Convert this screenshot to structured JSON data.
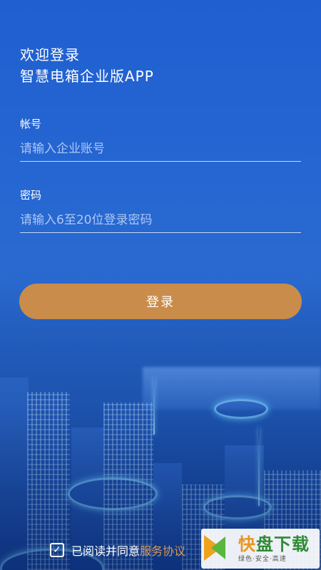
{
  "header": {
    "welcome": "欢迎登录",
    "app_name": "智慧电箱企业版APP"
  },
  "account": {
    "label": "帐号",
    "placeholder": "请输入企业账号",
    "value": ""
  },
  "password": {
    "label": "密码",
    "placeholder": "请输入6至20位登录密码",
    "value": ""
  },
  "login": {
    "label": "登录"
  },
  "agreement": {
    "checked": true,
    "check_mark": "✓",
    "text": "已阅读并同意",
    "link": "服务协议"
  },
  "watermark": {
    "brand_first": "快",
    "brand_rest": "盘下载",
    "tagline": "绿色·安全·高速"
  },
  "colors": {
    "background": "#2566d2",
    "button": "#c98c4a",
    "link": "#d79a55"
  }
}
